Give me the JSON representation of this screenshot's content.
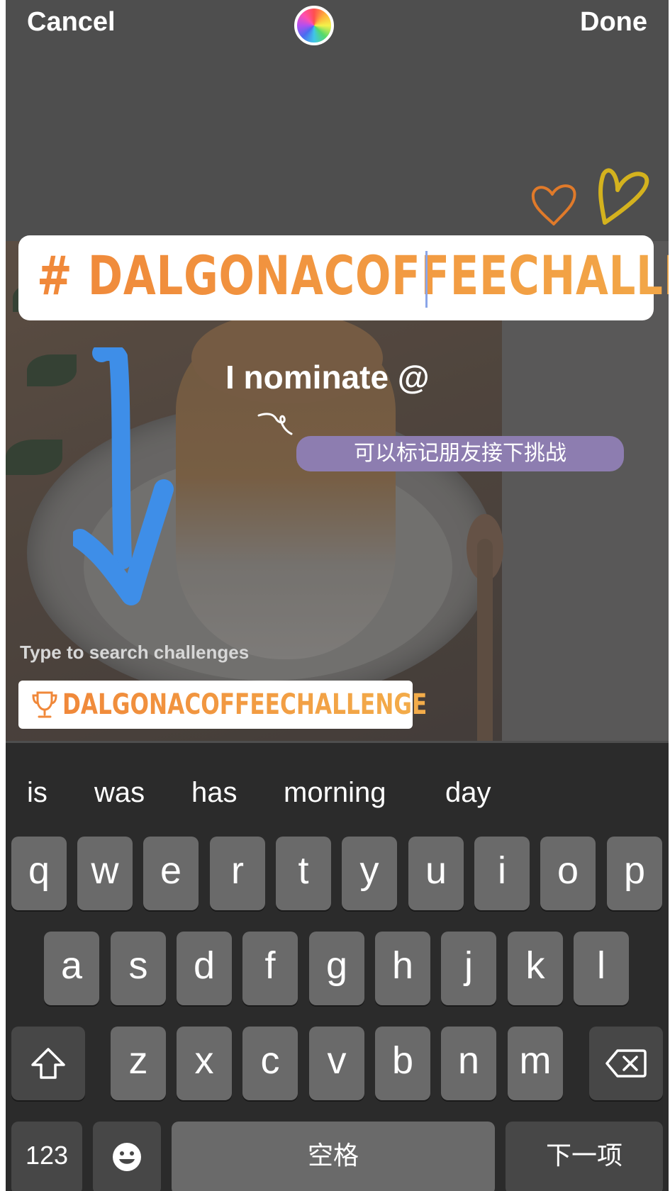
{
  "topbar": {
    "cancel": "Cancel",
    "done": "Done"
  },
  "hashtag": {
    "text": "# DALGONACOFFEECHALLENGE"
  },
  "nominate": {
    "text": "I nominate @"
  },
  "note_label": {
    "text": "可以标记朋友接下挑战"
  },
  "search": {
    "hint": "Type to search challenges",
    "suggestion": "DALGONACOFFEECHALLENGE"
  },
  "predictions": [
    "is",
    "was",
    "has",
    "morning",
    "day"
  ],
  "keyboard": {
    "row1": [
      "q",
      "w",
      "e",
      "r",
      "t",
      "y",
      "u",
      "i",
      "o",
      "p"
    ],
    "row2": [
      "a",
      "s",
      "d",
      "f",
      "g",
      "h",
      "j",
      "k",
      "l"
    ],
    "row3": [
      "z",
      "x",
      "c",
      "v",
      "b",
      "n",
      "m"
    ],
    "numbers": "123",
    "space": "空格",
    "next": "下一项"
  },
  "colors": {
    "accent_orange": "#f0883a",
    "label_purple": "#8d7db0",
    "arrow_blue": "#3e8ee8"
  }
}
